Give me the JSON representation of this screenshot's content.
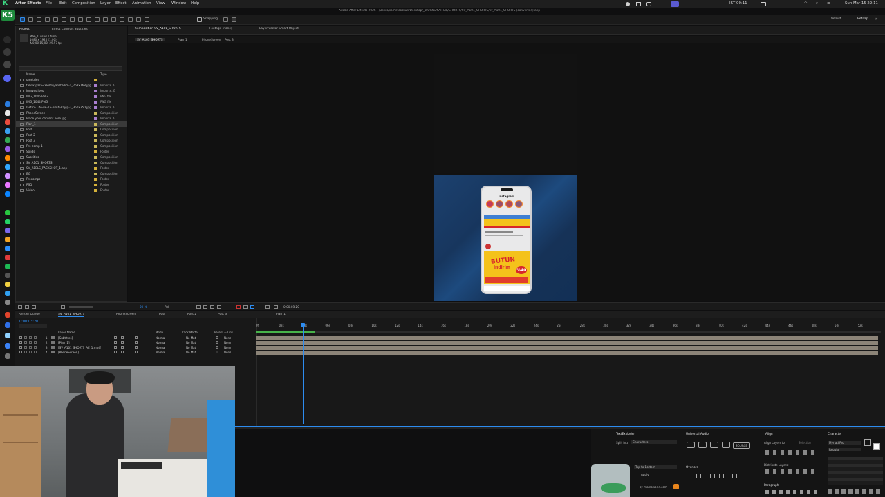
{
  "menubar": {
    "app": "After Effects",
    "items": [
      "File",
      "Edit",
      "Composition",
      "Layer",
      "Effect",
      "Animation",
      "View",
      "Window",
      "Help"
    ],
    "window_title": "Adobe After Effects 2026 - /Users/sametcoskun/Desktop/_WORKS/KARTAL/SHORTS/SV_A101_SHORTS/sv_A101_SHORTS (converted).aep",
    "datetime": "Sun Mar 15  22:11",
    "clock_extra": "IST 00:11"
  },
  "toolbar": {
    "snapping": "Snapping",
    "workspace_default": "Default",
    "workspace_active": "Retcap"
  },
  "project_panel": {
    "tab_project": "Project",
    "tab_effect_controls": "Effect Controls Subtitles",
    "selected_name": "Plan_1",
    "selected_used": "used 1 time",
    "selected_size": "1080 x 1920 (1.00)",
    "selected_duration": "Δ 0;00;15;00, 29.97 fps",
    "col_name": "Name",
    "col_type": "Type",
    "items": [
      {
        "name": "ometries",
        "type": "",
        "color": "#d4b13a",
        "selected": false
      },
      {
        "name": "tabak-para-cekildi-yaniltildim-1_768x768.jpg",
        "type": "Importe..G",
        "color": "#a97fcf",
        "selected": false
      },
      {
        "name": "images.jpeg",
        "type": "Importe..G",
        "color": "#a97fcf",
        "selected": false
      },
      {
        "name": "IMG_1045.PNG",
        "type": "PNG file",
        "color": "#a97fcf",
        "selected": false
      },
      {
        "name": "IMG_1044.PNG",
        "type": "PNG file",
        "color": "#a97fcf",
        "selected": false
      },
      {
        "name": "lastico...ite-ve-15-bin-tl-kayip-2_350x350.jpg",
        "type": "Importe..G",
        "color": "#a97fcf",
        "selected": false
      },
      {
        "name": "PhoneScreen",
        "type": "Composition",
        "color": "#c9b85a",
        "selected": false
      },
      {
        "name": "Place your content here.jpg",
        "type": "Importe..G",
        "color": "#a97fcf",
        "selected": false
      },
      {
        "name": "Plan_1",
        "type": "Composition",
        "color": "#c9b85a",
        "selected": true
      },
      {
        "name": "Post",
        "type": "Composition",
        "color": "#c9b85a",
        "selected": false
      },
      {
        "name": "Post 2",
        "type": "Composition",
        "color": "#c9b85a",
        "selected": false
      },
      {
        "name": "Post 3",
        "type": "Composition",
        "color": "#c9b85a",
        "selected": false
      },
      {
        "name": "Pre-comp 1",
        "type": "Composition",
        "color": "#c9b85a",
        "selected": false
      },
      {
        "name": "Solids",
        "type": "Folder",
        "color": "#d4b13a",
        "selected": false
      },
      {
        "name": "Subtitles",
        "type": "Composition",
        "color": "#c9b85a",
        "selected": false
      },
      {
        "name": "SV_A101_SHORTS",
        "type": "Composition",
        "color": "#c9b85a",
        "selected": false
      },
      {
        "name": "SV_REELS_PACKSHOT_1.aep",
        "type": "Folder",
        "color": "#d4b13a",
        "selected": false
      },
      {
        "name": "BG",
        "type": "Composition",
        "color": "#c9b85a",
        "selected": false
      },
      {
        "name": "Precomps",
        "type": "Folder",
        "color": "#d4b13a",
        "selected": false
      },
      {
        "name": "PSD",
        "type": "Folder",
        "color": "#d4b13a",
        "selected": false
      },
      {
        "name": "Video",
        "type": "Folder",
        "color": "#d4b13a",
        "selected": false
      }
    ],
    "bpc": "16 bpc"
  },
  "viewer": {
    "tab_composition": "Composition SV_A101_SHORTS",
    "tab_footage": "Footage (none)",
    "tab_layer": "Layer Vector Smart Object",
    "breadcrumbs": [
      "SV_A101_SHORTS",
      "Plan_1",
      "PhoneScreen",
      "Post 3"
    ],
    "zoom": "50 %",
    "quality": "Full",
    "timecode": "0:00:03:20",
    "phone_header": "Instagram",
    "promo_line1": "BUTUN",
    "promo_line2": "indirim",
    "promo_badge": "%40"
  },
  "timeline": {
    "tabs": [
      "Render Queue",
      "SV_A101_SHORTS",
      "PhoneScreen",
      "Post",
      "Post 2",
      "Post 3",
      "Plan_1"
    ],
    "current_time": "0:00:03:20",
    "col_layer_name": "Layer Name",
    "col_mode": "Mode",
    "col_track_matte": "Track Matte",
    "col_parent": "Parent & Link",
    "ruler": [
      "0f",
      "02s",
      "04s",
      "06s",
      "08s",
      "10s",
      "12s",
      "14s",
      "16s",
      "18s",
      "20s",
      "22s",
      "24s",
      "26s",
      "28s",
      "30s",
      "32s",
      "34s",
      "36s",
      "38s",
      "40s",
      "42s",
      "44s",
      "46s",
      "48s",
      "50s",
      "52s"
    ],
    "playhead_fraction": 0.075,
    "work_area_end_fraction": 0.094,
    "layers": [
      {
        "num": "1",
        "name": "[Subtitles]",
        "mode": "Normal",
        "matte": "No Mat",
        "parent": "None"
      },
      {
        "num": "2",
        "name": "[Plan_1]",
        "mode": "Normal",
        "matte": "No Mat",
        "parent": "None"
      },
      {
        "num": "3",
        "name": "[SV_A101_SHORTS_AE_1.mp4]",
        "mode": "Normal",
        "matte": "No Mat",
        "parent": "None"
      },
      {
        "num": "4",
        "name": "[PhoneScreen]",
        "mode": "Normal",
        "matte": "No Mat",
        "parent": "None"
      }
    ]
  },
  "bottom_panels": {
    "text_exploder": "TextExploder",
    "split_into_label": "Split Into",
    "split_into_value": "Characters",
    "order_value": "Top to Bottom",
    "apply": "Apply",
    "credit": "by mamoworld.com",
    "universal_audio": "Universal Audio",
    "source": "SOURCE",
    "overlord": "Overlord",
    "align": "Align",
    "align_layers_to": "Align Layers to:",
    "align_target": "Selection",
    "distribute_layers": "Distribute Layers:",
    "paragraph": "Paragraph",
    "character": "Character",
    "font": "Myriad Pro",
    "font_style": "Regular"
  },
  "colors": {
    "accent_blue": "#2d8cf0",
    "comp_bg": "#1a3b6a",
    "promo_yellow": "#f4c21b",
    "promo_red": "#d8262a",
    "dock_green": "#28c840",
    "brand_k": "#3ddc84"
  }
}
